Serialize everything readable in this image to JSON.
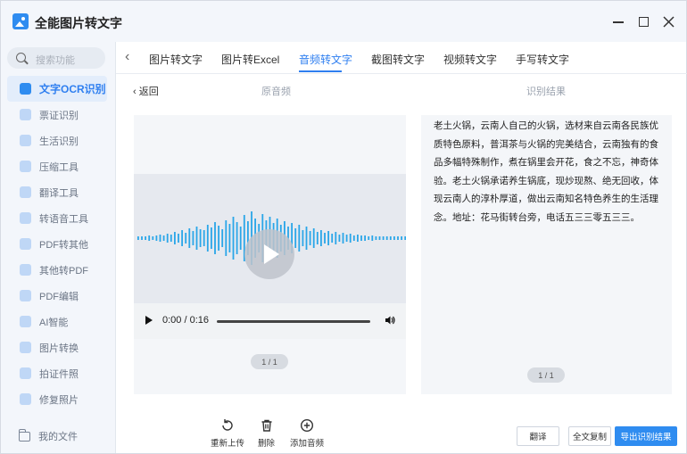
{
  "app": {
    "title": "全能图片转文字"
  },
  "search": {
    "placeholder": "搜索功能"
  },
  "sidebar": {
    "items": [
      {
        "label": "文字OCR识别",
        "icon": "ocr-icon"
      },
      {
        "label": "票证识别",
        "icon": "ticket-icon"
      },
      {
        "label": "生活识别",
        "icon": "life-icon"
      },
      {
        "label": "压缩工具",
        "icon": "compress-icon"
      },
      {
        "label": "翻译工具",
        "icon": "translate-icon"
      },
      {
        "label": "转语音工具",
        "icon": "voice-icon"
      },
      {
        "label": "PDF转其他",
        "icon": "pdf-icon"
      },
      {
        "label": "其他转PDF",
        "icon": "to-pdf-icon"
      },
      {
        "label": "PDF编辑",
        "icon": "pdf-edit-icon"
      },
      {
        "label": "AI智能",
        "icon": "ai-icon"
      },
      {
        "label": "图片转换",
        "icon": "image-convert-icon"
      },
      {
        "label": "拍证件照",
        "icon": "id-photo-icon"
      },
      {
        "label": "修复照片",
        "icon": "repair-icon"
      }
    ],
    "files_label": "我的文件"
  },
  "tabs": [
    {
      "label": "图片转文字"
    },
    {
      "label": "图片转Excel"
    },
    {
      "label": "音频转文字",
      "active": true
    },
    {
      "label": "截图转文字"
    },
    {
      "label": "视频转文字"
    },
    {
      "label": "手写转文字"
    }
  ],
  "back_label": "返回",
  "left_header": "原音频",
  "right_header": "识别结果",
  "player": {
    "time": "0:00 / 0:16"
  },
  "pager_left": "1 / 1",
  "pager_right": "1 / 1",
  "result_text": "老土火锅，云南人自己的火锅，选材来自云南各民族优质特色原料，普洱茶与火锅的完美结合，云南独有的食品多幅特殊制作，煮在锅里会开花，食之不忘，神奇体验。老土火锅承诺养生锅底，现炒现熬、绝无回收，体现云南人的淳朴厚道，做出云南知名特色养生的生活理念。地址：花马街转台旁，电话五三三零五三三。",
  "toolbar": {
    "reupload": "重新上传",
    "delete": "删除",
    "add_audio": "添加音频"
  },
  "actions": {
    "translate": "翻译",
    "copy_all": "全文复制",
    "export": "导出识别结果"
  },
  "colors": {
    "accent": "#2f8cf0",
    "wave": "#2aa6e8"
  }
}
